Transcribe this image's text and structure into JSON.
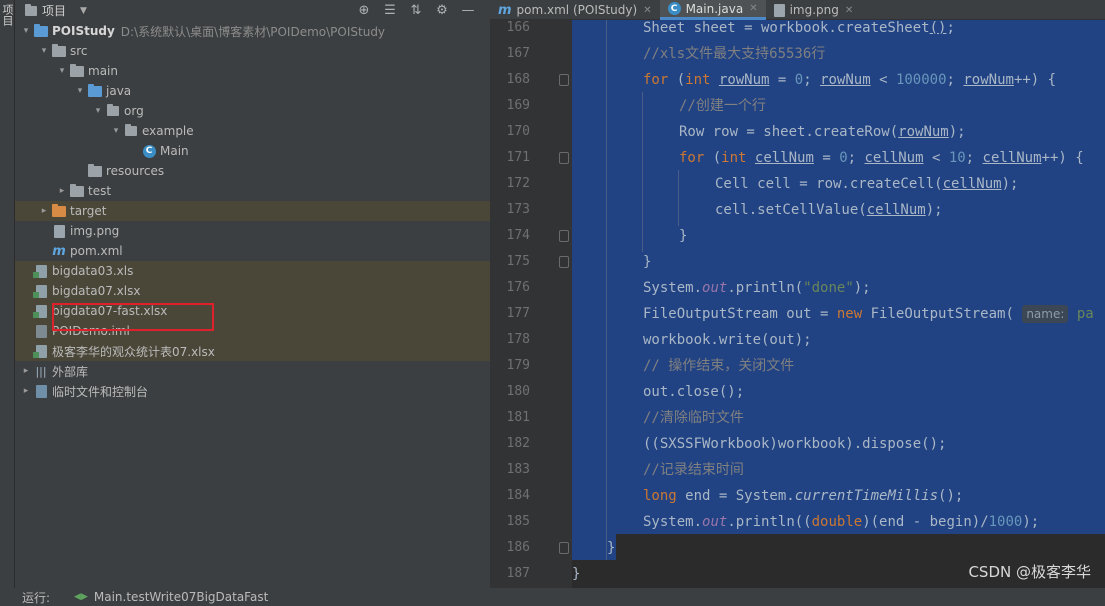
{
  "side_strip": {
    "label": "项目"
  },
  "project_panel": {
    "title": "项目",
    "tree": [
      {
        "label": "POIStudy",
        "path": "D:\\系统默认\\桌面\\博客素材\\POIDemo\\POIStudy",
        "indent": 0,
        "arrow": "open",
        "icon": "module-folder-icon",
        "bold": true,
        "hl": false
      },
      {
        "label": "src",
        "indent": 1,
        "arrow": "open",
        "icon": "folder-icon",
        "hl": false
      },
      {
        "label": "main",
        "indent": 2,
        "arrow": "open",
        "icon": "folder-icon",
        "hl": false
      },
      {
        "label": "java",
        "indent": 3,
        "arrow": "open",
        "icon": "source-folder-icon",
        "hl": false
      },
      {
        "label": "org",
        "indent": 4,
        "arrow": "open",
        "icon": "package-icon",
        "hl": false
      },
      {
        "label": "example",
        "indent": 5,
        "arrow": "open",
        "icon": "package-icon",
        "hl": false
      },
      {
        "label": "Main",
        "indent": 6,
        "arrow": "none",
        "icon": "class-icon",
        "hl": false
      },
      {
        "label": "resources",
        "indent": 3,
        "arrow": "none",
        "icon": "resources-folder-icon",
        "hl": false
      },
      {
        "label": "test",
        "indent": 2,
        "arrow": "closed",
        "icon": "folder-icon",
        "hl": false
      },
      {
        "label": "target",
        "indent": 1,
        "arrow": "closed",
        "icon": "excluded-folder-icon",
        "hl": true
      },
      {
        "label": "img.png",
        "indent": 1,
        "arrow": "none",
        "icon": "image-file-icon",
        "hl": false
      },
      {
        "label": "pom.xml",
        "indent": 1,
        "arrow": "none",
        "icon": "maven-icon",
        "hl": false
      },
      {
        "label": "bigdata03.xls",
        "indent": 0,
        "arrow": "none",
        "icon": "excel-file-icon",
        "hl": true
      },
      {
        "label": "bigdata07.xlsx",
        "indent": 0,
        "arrow": "none",
        "icon": "excel-file-icon",
        "hl": true
      },
      {
        "label": "bigdata07-fast.xlsx",
        "indent": 0,
        "arrow": "none",
        "icon": "excel-file-icon",
        "hl": true
      },
      {
        "label": "POIDemo.iml",
        "indent": 0,
        "arrow": "none",
        "icon": "iml-file-icon",
        "hl": true
      },
      {
        "label": "极客李华的观众统计表07.xlsx",
        "indent": 0,
        "arrow": "none",
        "icon": "excel-file-icon",
        "hl": true
      },
      {
        "label": "外部库",
        "indent": -1,
        "arrow": "closed",
        "icon": "library-icon",
        "hl": false
      },
      {
        "label": "临时文件和控制台",
        "indent": -1,
        "arrow": "closed",
        "icon": "scratch-icon",
        "hl": false
      }
    ]
  },
  "tabs": [
    {
      "label": "pom.xml (POIStudy)",
      "icon": "m",
      "active": false
    },
    {
      "label": "Main.java",
      "icon": "c",
      "active": true
    },
    {
      "label": "img.png",
      "icon": "img",
      "active": false
    }
  ],
  "editor": {
    "line_numbers": [
      "166",
      "167",
      "168",
      "169",
      "170",
      "171",
      "172",
      "173",
      "174",
      "175",
      "176",
      "177",
      "178",
      "179",
      "180",
      "181",
      "182",
      "183",
      "184",
      "185",
      "186",
      "187"
    ],
    "hint_label": "name:",
    "watermark": "CSDN @极客李华"
  },
  "status": {
    "run_label": "运行:",
    "run_config": "Main.testWrite07BigDataFast"
  },
  "colors": {
    "selection": "#214283",
    "keyword": "#cc7832",
    "number": "#6897bb",
    "string": "#6a8759",
    "comment": "#808080",
    "highlight_row": "#4a4739"
  }
}
